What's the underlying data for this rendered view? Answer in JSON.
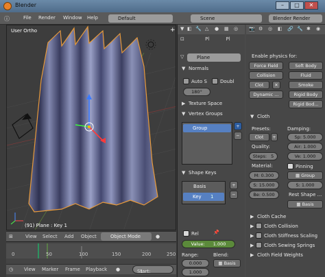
{
  "window": {
    "title": "Blender",
    "min": "–",
    "max": "□",
    "close": "✕"
  },
  "menu": {
    "file": "File",
    "render": "Render",
    "window": "Window",
    "help": "Help",
    "layout": "Default",
    "scene": "Scene",
    "engine": "Blender Render"
  },
  "viewport": {
    "label": "User Ortho",
    "status": "(91) Plane : Key 1"
  },
  "vp_header": {
    "view": "View",
    "select": "Select",
    "add": "Add",
    "object": "Object",
    "mode": "Object Mode"
  },
  "timeline": {
    "view": "View",
    "marker": "Marker",
    "frame": "Frame",
    "playback": "Playback",
    "start": "Start:",
    "start_val": "1",
    "ticks": [
      "0",
      "50",
      "100",
      "150",
      "200",
      "250"
    ]
  },
  "props": {
    "object_name": "Plane",
    "pin_label": "Pl",
    "normals": "Normals",
    "auto_s": "Auto S",
    "double": "Doubl",
    "angle": "180°",
    "texture_space": "Texture Space",
    "vertex_groups": "Vertex Groups",
    "group_item": "Group",
    "shape_keys": "Shape Keys",
    "basis": "Basis",
    "key": "Key",
    "key_val": "1",
    "rel": "Rel",
    "value_label": "Value:",
    "value": "1.000",
    "range_label": "Range:",
    "range_min": "0.000",
    "range_max": "1.000",
    "blend_label": "Blend:",
    "blend_val": "Basis"
  },
  "physics": {
    "enable_label": "Enable physics for:",
    "force_field": "Force Field",
    "soft_body": "Soft Body",
    "collision": "Collision",
    "fluid": "Fluid",
    "cloth": "Clot",
    "smoke": "Smoke",
    "dynamic": "Dynamic ...",
    "rigid_body": "Rigid Body",
    "rigid_con": "Rigid Bod..."
  },
  "cloth": {
    "title": "Cloth",
    "presets_label": "Presets:",
    "presets_val": "Clot",
    "damping_label": "Damping:",
    "spring": "Sp: 5.000",
    "quality_label": "Quality:",
    "air": "Air: 1.000",
    "steps": "Steps:",
    "steps_val": "5",
    "vel": "Ve: 1.000",
    "material_label": "Material:",
    "pinning": "Pinning",
    "mass": "M: 0.300",
    "group": "Group",
    "stiff": "S: 15.000",
    "bend": "Be: 0.500",
    "rest_shape": "Rest Shape ...",
    "basis": "Basis",
    "cache": "Cloth Cache",
    "collision": "Cloth Collision",
    "stiffness_scaling": "Cloth Stiffness Scaling",
    "sewing": "Cloth Sewing Springs",
    "field_weights": "Cloth Field Weights"
  }
}
